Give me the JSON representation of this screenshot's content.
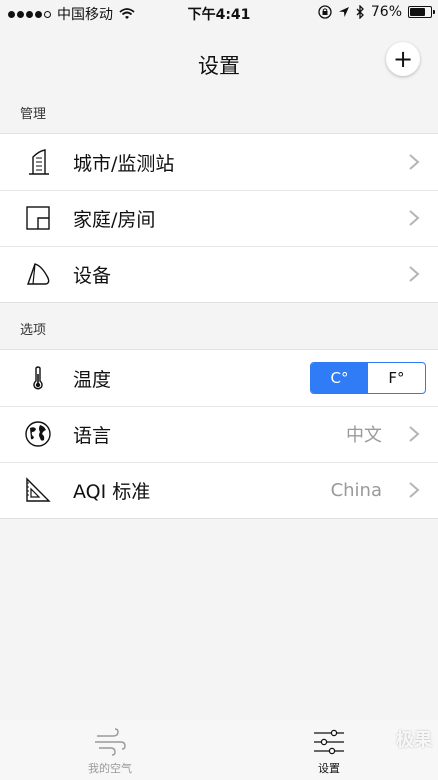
{
  "status": {
    "carrier": "中国移动",
    "time": "下午4:41",
    "battery": "76%",
    "battery_level": 0.76
  },
  "nav": {
    "title": "设置",
    "add_label": "+"
  },
  "manage": {
    "header": "管理",
    "items": [
      {
        "label": "城市/监测站",
        "icon": "building-icon"
      },
      {
        "label": "家庭/房间",
        "icon": "floorplan-icon"
      },
      {
        "label": "设备",
        "icon": "device-icon"
      }
    ]
  },
  "options": {
    "header": "选项",
    "temperature": {
      "label": "温度",
      "celsius": "C°",
      "fahrenheit": "F°",
      "selected": "celsius"
    },
    "language": {
      "label": "语言",
      "value": "中文"
    },
    "aqi": {
      "label": "AQI 标准",
      "value": "China"
    }
  },
  "tabs": [
    {
      "label": "我的空气",
      "icon": "wind-icon",
      "active": false
    },
    {
      "label": "设置",
      "icon": "sliders-icon",
      "active": true
    }
  ],
  "watermark": "极果",
  "colors": {
    "accent": "#2f7cf6"
  }
}
